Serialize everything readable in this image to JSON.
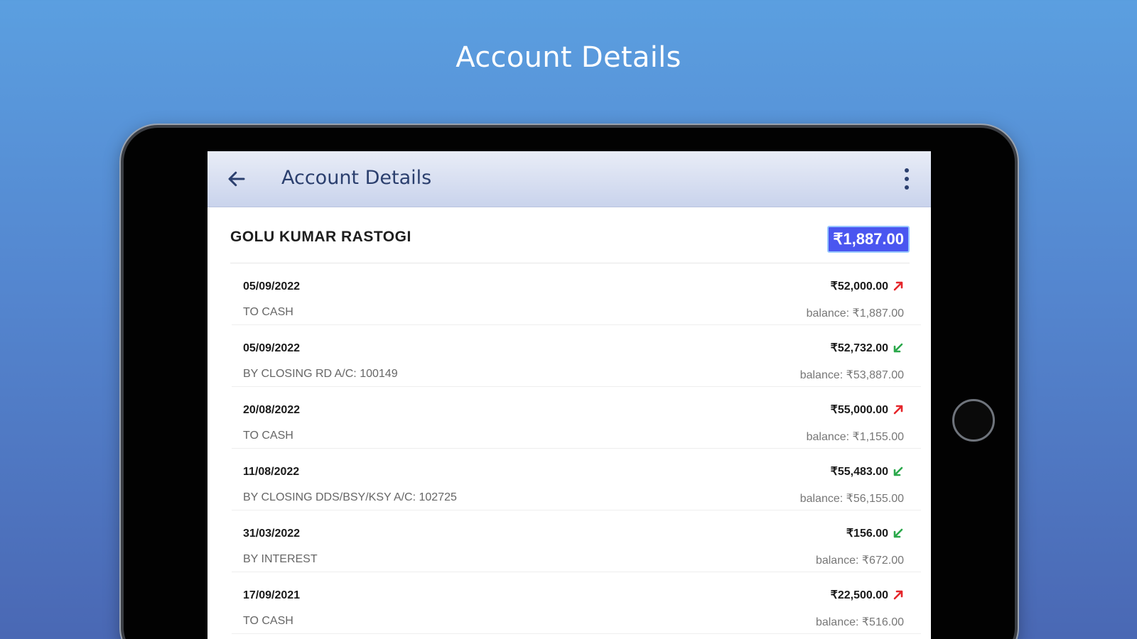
{
  "promo": {
    "title": "Account Details"
  },
  "app_bar": {
    "title": "Account Details"
  },
  "account": {
    "name": "GOLU KUMAR RASTOGI",
    "balance": "₹1,887.00"
  },
  "transactions": [
    {
      "date": "05/09/2022",
      "description": "TO CASH",
      "amount": "₹52,000.00",
      "direction": "debit",
      "balance": "balance: ₹1,887.00"
    },
    {
      "date": "05/09/2022",
      "description": "BY CLOSING RD A/C: 100149",
      "amount": "₹52,732.00",
      "direction": "credit",
      "balance": "balance: ₹53,887.00"
    },
    {
      "date": "20/08/2022",
      "description": "TO CASH",
      "amount": "₹55,000.00",
      "direction": "debit",
      "balance": "balance: ₹1,155.00"
    },
    {
      "date": "11/08/2022",
      "description": "BY CLOSING DDS/BSY/KSY A/C: 102725",
      "amount": "₹55,483.00",
      "direction": "credit",
      "balance": "balance: ₹56,155.00"
    },
    {
      "date": "31/03/2022",
      "description": "BY INTEREST",
      "amount": "₹156.00",
      "direction": "credit",
      "balance": "balance: ₹672.00"
    },
    {
      "date": "17/09/2021",
      "description": "TO CASH",
      "amount": "₹22,500.00",
      "direction": "debit",
      "balance": "balance: ₹516.00"
    }
  ],
  "icons": {
    "back": "arrow-left-icon",
    "menu": "more-vertical-icon",
    "debit": "arrow-up-right-icon",
    "credit": "arrow-down-left-icon"
  },
  "colors": {
    "debit": "#e5262b",
    "credit": "#2aa84a",
    "badge": "#4a56f0",
    "app_bar_text": "#2b3f6e"
  }
}
